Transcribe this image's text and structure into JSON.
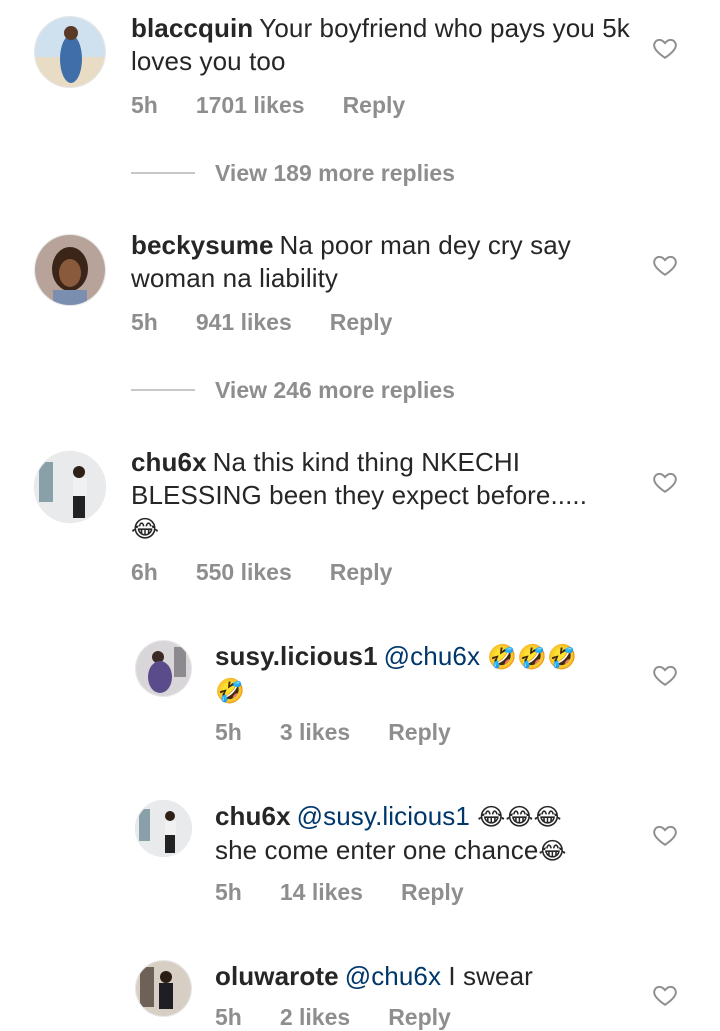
{
  "comments": [
    {
      "username": "blaccquin",
      "text": "Your boyfriend who pays you 5k loves you too",
      "time": "5h",
      "likes": "1701 likes",
      "reply": "Reply",
      "view_more": "View 189 more replies"
    },
    {
      "username": "beckysume",
      "text": "Na poor man dey cry say woman na liability",
      "time": "5h",
      "likes": "941 likes",
      "reply": "Reply",
      "view_more": "View 246 more replies"
    },
    {
      "username": "chu6x",
      "text": "Na this kind thing NKECHI BLESSING  been they expect before.....",
      "emoji": "😂",
      "time": "6h",
      "likes": "550 likes",
      "reply": "Reply"
    }
  ],
  "replies": [
    {
      "username": "susy.licious1",
      "mention": "@chu6x",
      "emoji1": "🤣🤣🤣",
      "emoji2": "🤣",
      "time": "5h",
      "likes": "3 likes",
      "reply": "Reply"
    },
    {
      "username": "chu6x",
      "mention": "@susy.licious1",
      "emoji1": "😂😂😂",
      "text": "she come enter one chance",
      "emoji2": "😂",
      "time": "5h",
      "likes": "14 likes",
      "reply": "Reply"
    },
    {
      "username": "oluwarote",
      "mention": "@chu6x",
      "text": "I swear",
      "time": "5h",
      "likes": "2 likes",
      "reply": "Reply"
    }
  ]
}
